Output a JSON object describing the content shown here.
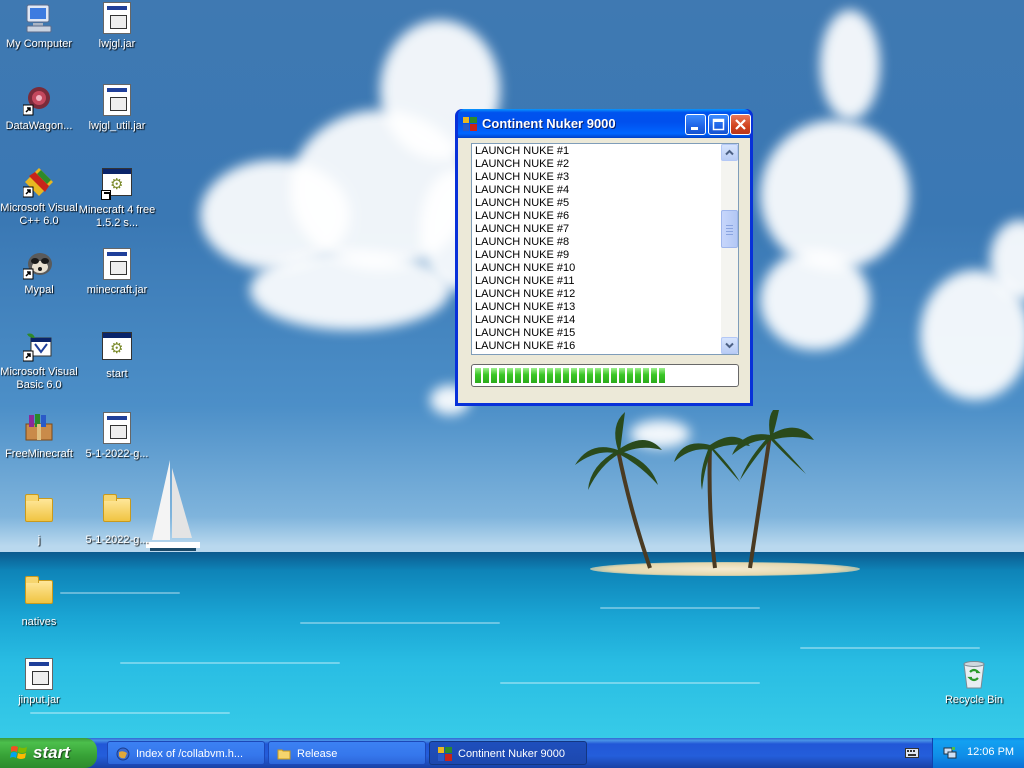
{
  "desktop": {
    "icons": [
      {
        "label": "My Computer",
        "icon": "my-computer-icon"
      },
      {
        "label": "lwjgl.jar",
        "icon": "jar-file-icon"
      },
      {
        "label": "DataWagon...",
        "icon": "datawagon-shortcut-icon"
      },
      {
        "label": "lwjgl_util.jar",
        "icon": "jar-file-icon"
      },
      {
        "label": "Microsoft Visual C++ 6.0",
        "icon": "visual-cpp-shortcut-icon"
      },
      {
        "label": "Minecraft 4 free 1.5.2 s...",
        "icon": "application-shortcut-icon"
      },
      {
        "label": "Mypal",
        "icon": "mypal-shortcut-icon"
      },
      {
        "label": "minecraft.jar",
        "icon": "jar-file-icon"
      },
      {
        "label": "Microsoft Visual Basic 6.0",
        "icon": "visual-basic-shortcut-icon"
      },
      {
        "label": "start",
        "icon": "application-icon"
      },
      {
        "label": "FreeMinecraft",
        "icon": "winrar-archive-icon"
      },
      {
        "label": "5-1-2022-g...",
        "icon": "jar-file-icon"
      },
      {
        "label": "j",
        "icon": "folder-icon"
      },
      {
        "label": "5-1-2022-g...",
        "icon": "folder-icon"
      },
      {
        "label": "natives",
        "icon": "folder-icon"
      },
      {
        "label": "jinput.jar",
        "icon": "jar-file-icon"
      },
      {
        "label": "Recycle Bin",
        "icon": "recycle-bin-icon"
      }
    ]
  },
  "window": {
    "title": "Continent Nuker 9000",
    "list_items": [
      "LAUNCH NUKE #1",
      "LAUNCH NUKE #2",
      "LAUNCH NUKE #3",
      "LAUNCH NUKE #4",
      "LAUNCH NUKE #5",
      "LAUNCH NUKE #6",
      "LAUNCH NUKE #7",
      "LAUNCH NUKE #8",
      "LAUNCH NUKE #9",
      "LAUNCH NUKE #10",
      "LAUNCH NUKE #11",
      "LAUNCH NUKE #12",
      "LAUNCH NUKE #13",
      "LAUNCH NUKE #14",
      "LAUNCH NUKE #15",
      "LAUNCH NUKE #16"
    ],
    "progress_fraction": 0.74
  },
  "taskbar": {
    "start_label": "start",
    "tasks": [
      {
        "label": "Index of /collabvm.h...",
        "icon": "browser-icon",
        "active": false
      },
      {
        "label": "Release",
        "icon": "folder-icon",
        "active": false
      },
      {
        "label": "Continent Nuker 9000",
        "icon": "app-window-icon",
        "active": true
      }
    ],
    "clock": "12:06 PM"
  },
  "colors": {
    "titlebar": "#0054e3",
    "progress_green": "#2fb51f",
    "taskbar_blue": "#245edb",
    "start_green": "#3c9c3c"
  }
}
